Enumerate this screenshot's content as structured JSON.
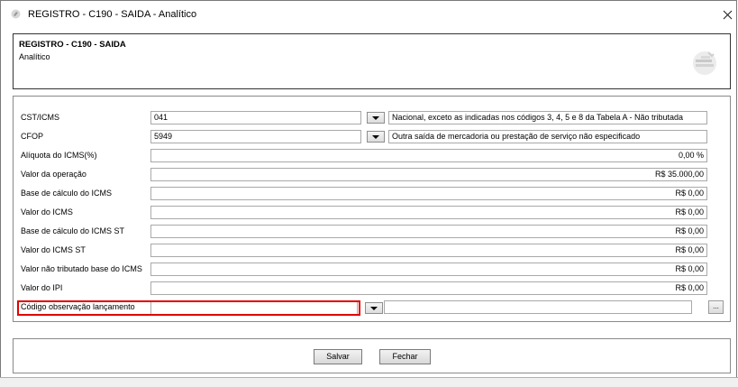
{
  "window": {
    "title": "REGISTRO - C190 - SAIDA - Analítico"
  },
  "header": {
    "title": "REGISTRO - C190 - SAIDA",
    "subtitle": "Analítico"
  },
  "form": {
    "cst": {
      "label": "CST/ICMS",
      "value": "041",
      "description": "Nacional, exceto as indicadas nos códigos 3, 4, 5 e 8 da Tabela A - Não tributada"
    },
    "cfop": {
      "label": "CFOP",
      "value": "5949",
      "description": "Outra saída de mercadoria ou prestação de serviço não especificado"
    },
    "aliquota": {
      "label": "Alíquota do ICMS(%)",
      "value": "0,00 %"
    },
    "valor_operacao": {
      "label": "Valor da operação",
      "value": "R$ 35.000,00"
    },
    "base_icms": {
      "label": "Base de cálculo do ICMS",
      "value": "R$ 0,00"
    },
    "valor_icms": {
      "label": "Valor do ICMS",
      "value": "R$ 0,00"
    },
    "base_icms_st": {
      "label": "Base de cálculo do ICMS ST",
      "value": "R$ 0,00"
    },
    "valor_icms_st": {
      "label": "Valor do ICMS ST",
      "value": "R$ 0,00"
    },
    "valor_nao_tributado": {
      "label": "Valor não tributado base do ICMS",
      "value": "R$ 0,00"
    },
    "valor_ipi": {
      "label": "Valor do IPI",
      "value": "R$ 0,00"
    },
    "codigo_obs": {
      "label": "Código observação lançamento",
      "value": "",
      "description": ""
    },
    "ellipsis_label": "..."
  },
  "footer": {
    "save_label": "Salvar",
    "close_label": "Fechar"
  },
  "icons": {
    "app": "app-logo-icon",
    "close": "close-icon",
    "dropdown": "chevron-down-icon",
    "header_logo": "document-logo-icon"
  },
  "colors": {
    "highlight": "#e00000"
  }
}
